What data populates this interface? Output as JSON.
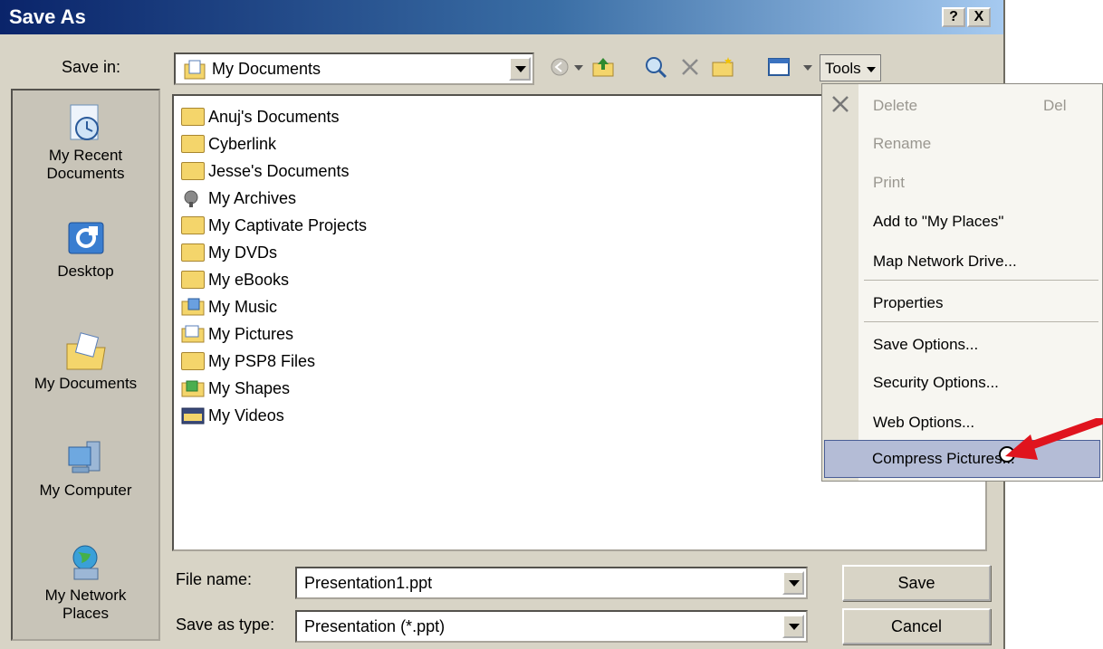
{
  "window": {
    "title": "Save As"
  },
  "title_buttons": {
    "help": "?",
    "close": "X"
  },
  "save_in": {
    "label": "Save in:",
    "value": "My Documents"
  },
  "toolbar": {
    "tools_label": "Tools"
  },
  "places": [
    {
      "label": "My Recent\nDocuments"
    },
    {
      "label": "Desktop"
    },
    {
      "label": "My Documents"
    },
    {
      "label": "My Computer"
    },
    {
      "label": "My Network\nPlaces"
    }
  ],
  "files": [
    {
      "name": "Anuj's Documents",
      "icon": "folder"
    },
    {
      "name": "Cyberlink",
      "icon": "folder"
    },
    {
      "name": "Jesse's Documents",
      "icon": "folder"
    },
    {
      "name": "My Archives",
      "icon": "archive"
    },
    {
      "name": "My Captivate Projects",
      "icon": "folder"
    },
    {
      "name": "My DVDs",
      "icon": "folder"
    },
    {
      "name": "My eBooks",
      "icon": "folder"
    },
    {
      "name": "My Music",
      "icon": "music-folder"
    },
    {
      "name": "My Pictures",
      "icon": "pictures-folder"
    },
    {
      "name": "My PSP8 Files",
      "icon": "folder"
    },
    {
      "name": "My Shapes",
      "icon": "shapes-folder"
    },
    {
      "name": "My Videos",
      "icon": "videos-folder"
    }
  ],
  "file_name": {
    "label": "File name:",
    "value": "Presentation1.ppt"
  },
  "save_as_type": {
    "label": "Save as type:",
    "value": "Presentation (*.ppt)"
  },
  "buttons": {
    "save": "Save",
    "cancel": "Cancel"
  },
  "tools_menu": {
    "items": [
      {
        "label": "Delete",
        "shortcut": "Del",
        "disabled": true
      },
      {
        "label": "Rename",
        "disabled": true
      },
      {
        "label": "Print",
        "disabled": true
      },
      {
        "label": "Add to \"My Places\"",
        "disabled": false
      },
      {
        "label": "Map Network Drive...",
        "disabled": false
      },
      {
        "label": "Properties",
        "disabled": false
      },
      {
        "label": "Save Options...",
        "disabled": false
      },
      {
        "label": "Security Options...",
        "disabled": false
      },
      {
        "label": "Web Options...",
        "disabled": false
      },
      {
        "label": "Compress Pictures...",
        "disabled": false,
        "highlighted": true
      }
    ]
  },
  "colors": {
    "title_start": "#0a246a",
    "title_end": "#a6caf0",
    "menu_highlight": "#b4bcd6",
    "annotation_arrow": "#e0141e"
  }
}
